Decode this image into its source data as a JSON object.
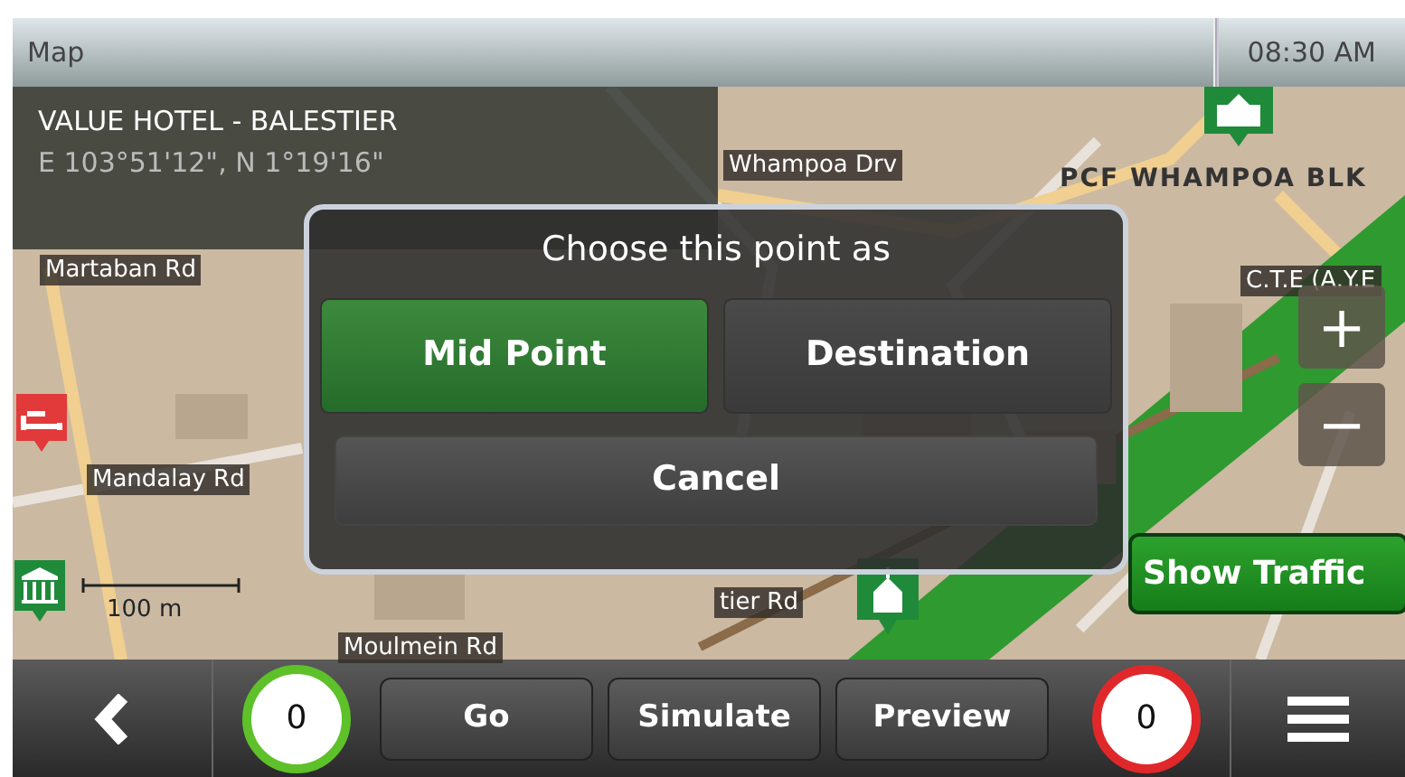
{
  "status_bar": {
    "title": "Map",
    "time": "08:30 AM"
  },
  "location": {
    "name": "VALUE HOTEL - BALESTIER",
    "coordinates": "E 103°51'12\", N 1°19'16\""
  },
  "map": {
    "labels": [
      {
        "kind": "road",
        "text": "Martaban Rd"
      },
      {
        "kind": "road",
        "text": "Whampoa Drv"
      },
      {
        "kind": "place",
        "text": "PCF WHAMPOA BLK"
      },
      {
        "kind": "road",
        "text": "C.T.E (A.Y.E"
      },
      {
        "kind": "road",
        "text": "Mandalay Rd"
      },
      {
        "kind": "road",
        "text": "tier Rd"
      },
      {
        "kind": "road",
        "text": "Moulmein Rd"
      }
    ],
    "scale": "100 m"
  },
  "dialog": {
    "title": "Choose this point as",
    "options": [
      {
        "label": "Mid Point",
        "selected": true
      },
      {
        "label": "Destination",
        "selected": false
      }
    ],
    "cancel": "Cancel"
  },
  "zoom_controls": [
    "+",
    "−"
  ],
  "show_traffic": "Show Traffic",
  "toolbar": [
    {
      "kind": "back"
    },
    {
      "kind": "counter",
      "value": "0",
      "color": "#5ec12a"
    },
    {
      "kind": "button",
      "label": "Go"
    },
    {
      "kind": "button",
      "label": "Simulate"
    },
    {
      "kind": "button",
      "label": "Preview"
    },
    {
      "kind": "counter",
      "value": "0",
      "color": "#e0282a"
    },
    {
      "kind": "menu"
    }
  ]
}
